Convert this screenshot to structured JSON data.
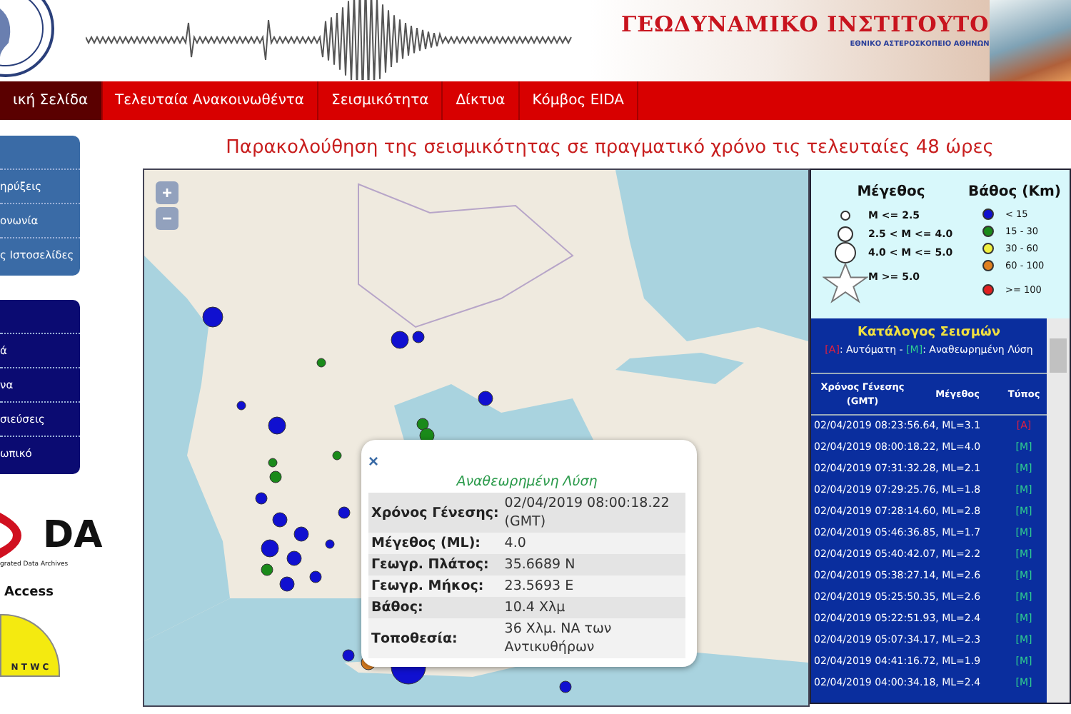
{
  "header": {
    "title": "ΓΕΩΔΥΝΑΜΙΚΟ ΙΝΣΤΙΤΟΥΤΟ",
    "subtitle": "ΕΘΝΙΚΟ ΑΣΤΕΡΟΣΚΟΠΕΙΟ ΑΘΗΝΩΝ"
  },
  "nav": [
    {
      "label": "ική Σελίδα",
      "selected": true
    },
    {
      "label": "Τελευταία Ανακοινωθέντα",
      "selected": false
    },
    {
      "label": "Σεισμικότητα",
      "selected": false
    },
    {
      "label": "Δίκτυα",
      "selected": false
    },
    {
      "label": "Κόμβος EIDA",
      "selected": false
    }
  ],
  "heading": "Παρακολούθηση της σεισμικότητας σε πραγματικό χρόνο τις τελευταίες 48 ώρες",
  "sidebar": {
    "menus": [
      {
        "kind": "light",
        "items": [
          "ηρύξεις",
          "ονωνία",
          "ς Ιστοσελίδες"
        ]
      },
      {
        "kind": "dark",
        "items": [
          "ά",
          "να",
          "σιεύσεις",
          "ωπικό"
        ]
      }
    ],
    "eida_logo": {
      "mark": "DA",
      "caption": "grated Data Archives"
    },
    "access": "Access",
    "seal": "N T W C"
  },
  "legend": {
    "magnitude_title": "Μέγεθος",
    "magnitudes": [
      {
        "kind": "small",
        "label": "M <= 2.5"
      },
      {
        "kind": "medium",
        "label": "2.5 < M <= 4.0"
      },
      {
        "kind": "large",
        "label": "4.0 < M <= 5.0"
      },
      {
        "kind": "star",
        "label": "M >= 5.0"
      }
    ],
    "depth_title": "Βάθος (Km)",
    "depths": [
      {
        "color": "#1010d0",
        "label": "< 15"
      },
      {
        "color": "#1a8a1a",
        "label": "15 - 30"
      },
      {
        "color": "#f0f040",
        "label": "30 - 60"
      },
      {
        "color": "#e08020",
        "label": "60 - 100"
      },
      {
        "color": "#e02020",
        "label": ">= 100"
      }
    ]
  },
  "catalog": {
    "title": "Κατάλογος Σεισμών",
    "key": [
      {
        "kind": "automatic",
        "text": "[A]"
      },
      {
        "kind": "plain",
        "text": ": Αυτόματη - "
      },
      {
        "kind": "revised",
        "text": "[M]"
      },
      {
        "kind": "plain",
        "text": ": Αναθεωρημένη Λύση"
      }
    ],
    "columns": [
      "Χρόνος Γένεσης (GMT)",
      "Μέγεθος",
      "Τύπος"
    ],
    "rows": [
      {
        "event": "02/04/2019 08:23:56.64, ML=3.1",
        "kind": "automatic",
        "type": "[A]"
      },
      {
        "event": "02/04/2019 08:00:18.22, ML=4.0",
        "kind": "revised",
        "type": "[M]"
      },
      {
        "event": "02/04/2019 07:31:32.28, ML=2.1",
        "kind": "revised",
        "type": "[M]"
      },
      {
        "event": "02/04/2019 07:29:25.76, ML=1.8",
        "kind": "revised",
        "type": "[M]"
      },
      {
        "event": "02/04/2019 07:28:14.60, ML=2.8",
        "kind": "revised",
        "type": "[M]"
      },
      {
        "event": "02/04/2019 05:46:36.85, ML=1.7",
        "kind": "revised",
        "type": "[M]"
      },
      {
        "event": "02/04/2019 05:40:42.07, ML=2.2",
        "kind": "revised",
        "type": "[M]"
      },
      {
        "event": "02/04/2019 05:38:27.14, ML=2.6",
        "kind": "revised",
        "type": "[M]"
      },
      {
        "event": "02/04/2019 05:25:50.35, ML=2.6",
        "kind": "revised",
        "type": "[M]"
      },
      {
        "event": "02/04/2019 05:22:51.93, ML=2.4",
        "kind": "revised",
        "type": "[M]"
      },
      {
        "event": "02/04/2019 05:07:34.17, ML=2.3",
        "kind": "revised",
        "type": "[M]"
      },
      {
        "event": "02/04/2019 04:41:16.72, ML=1.9",
        "kind": "revised",
        "type": "[M]"
      },
      {
        "event": "02/04/2019 04:00:34.18, ML=2.4",
        "kind": "revised",
        "type": "[M]"
      }
    ]
  },
  "map": {
    "zoom_in": "+",
    "zoom_out": "−",
    "popup": {
      "close": "×",
      "title": "Αναθεωρημένη Λύση",
      "rows": [
        {
          "label": "Χρόνος Γένεσης:",
          "value": "02/04/2019 08:00:18.22 (GMT)"
        },
        {
          "label": "Μέγεθος (ML):",
          "value": "4.0"
        },
        {
          "label": "Γεωγρ. Πλάτος:",
          "value": "35.6689 N"
        },
        {
          "label": "Γεωγρ. Μήκος:",
          "value": "23.5693 E"
        },
        {
          "label": "Βάθος:",
          "value": "10.4 Χλμ"
        },
        {
          "label": "Τοποθεσία:",
          "value": "36 Χλμ. ΝΑ των Αντικυθήρων"
        }
      ]
    }
  }
}
